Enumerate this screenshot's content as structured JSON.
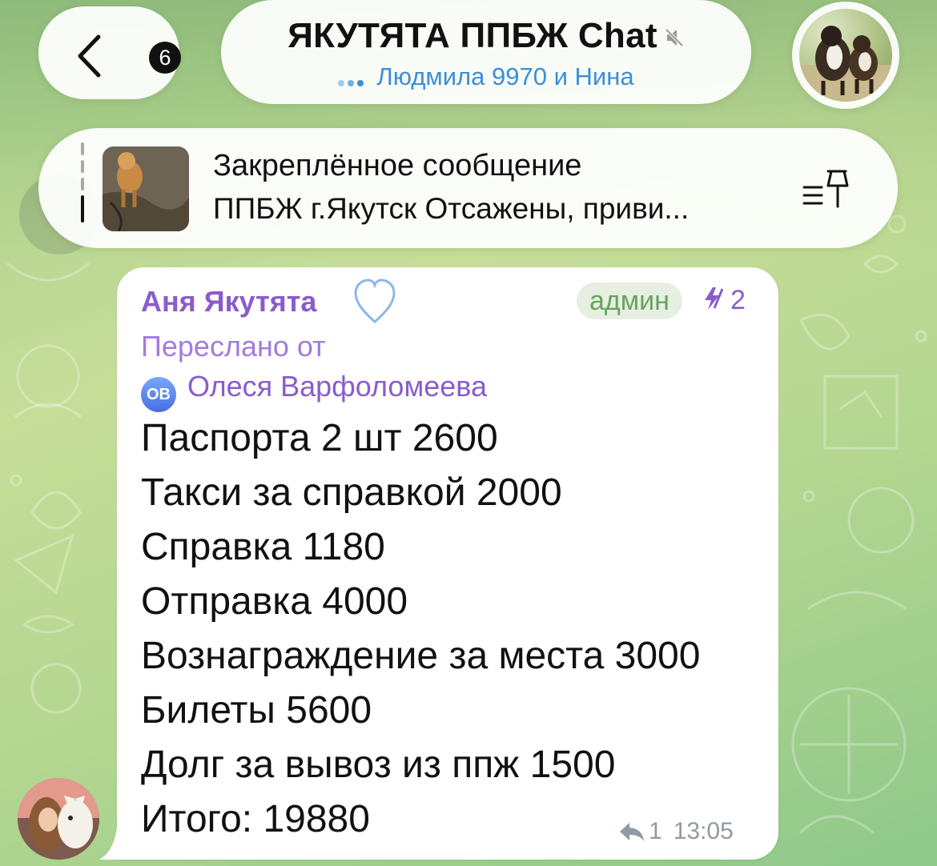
{
  "header": {
    "back_badge": "6",
    "title": "ЯКУТЯТА ППБЖ Chat",
    "subtitle": "Людмила 9970 и Нина"
  },
  "pinned": {
    "title": "Закреплённое сообщение",
    "text": "ППБЖ г.Якутск Отсажены, приви..."
  },
  "message": {
    "sender": "Аня Якутята",
    "role_badge": "админ",
    "boost_count": "2",
    "forwarded_label": "Переслано от",
    "forwarded_initials": "ОВ",
    "forwarded_from": "Олеся Варфоломеева",
    "lines": [
      "Паспорта 2 шт 2600",
      "Такси за справкой 2000",
      "Справка 1180",
      "Отправка 4000",
      "Вознаграждение за места 3000",
      "Билеты 5600",
      "Долг за вывоз из ппж 1500",
      "Итого: 19880"
    ],
    "reply_count": "1",
    "time": "13:05"
  },
  "colors": {
    "accent_blue": "#3a8fd9",
    "sender_purple": "#8a5cc9",
    "admin_green": "#67a35d"
  },
  "icons": [
    "chevron-left-icon",
    "mute-icon",
    "typing-indicator-icon",
    "pin-list-icon",
    "heart-icon",
    "boost-icon",
    "reply-icon"
  ]
}
